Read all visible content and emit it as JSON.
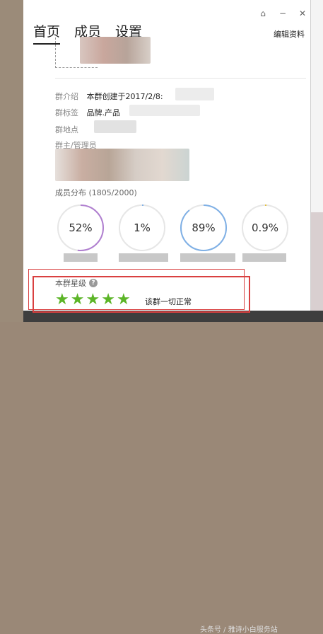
{
  "tabs": [
    {
      "label": "首页",
      "active": true
    },
    {
      "label": "成员",
      "active": false
    },
    {
      "label": "设置",
      "active": false
    }
  ],
  "window_controls": {
    "home_icon": "⌂",
    "minimize": "−",
    "close": "✕"
  },
  "edit_link": "编辑资料",
  "info": {
    "intro_label": "群介绍",
    "intro_value": "本群创建于2017/2/8:",
    "tags_label": "群标签",
    "tags_value": "品牌.产品",
    "location_label": "群地点",
    "owner_label": "群主/管理员"
  },
  "member_dist": {
    "title": "成员分布",
    "count": "(1805/2000)",
    "circles": [
      {
        "value": "52%",
        "fraction": 0.52,
        "color": "#b07fd0"
      },
      {
        "value": "1%",
        "fraction": 0.01,
        "color": "#7fb0e6"
      },
      {
        "value": "89%",
        "fraction": 0.89,
        "color": "#7fb0e6"
      },
      {
        "value": "0.9%",
        "fraction": 0.009,
        "color": "#e6c03c"
      }
    ]
  },
  "rating": {
    "title": "本群星级",
    "help_icon": "?",
    "stars": 5,
    "star_char": "★",
    "status": "该群一切正常"
  },
  "bottom_strip": "头条号 / 雅诗小白服务站"
}
